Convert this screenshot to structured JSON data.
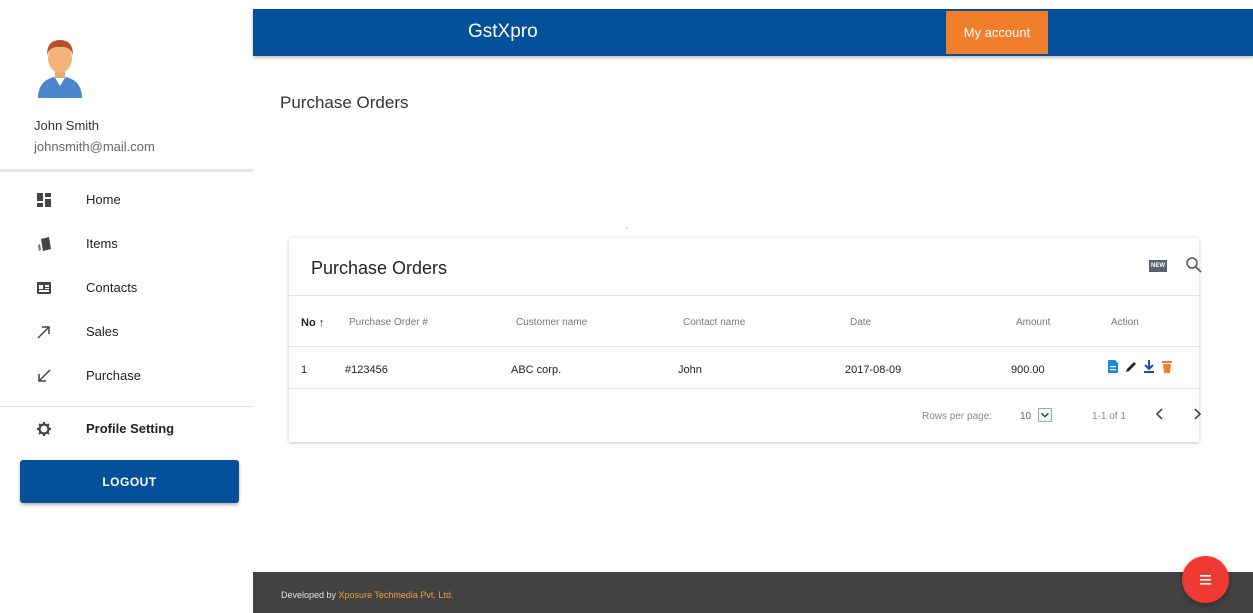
{
  "colors": {
    "primary": "#05509a",
    "accent": "#f07e2a",
    "fab": "#ef3a34",
    "footer_bg": "#424242",
    "action_blue": "#1e88e5",
    "action_orange": "#f07e2a"
  },
  "sidebar": {
    "user": {
      "name": "John Smith",
      "email": "johnsmith@mail.com",
      "avatar_icon": "user-avatar-icon"
    },
    "items": [
      {
        "label": "Home",
        "icon": "dashboard-icon"
      },
      {
        "label": "Items",
        "icon": "items-icon"
      },
      {
        "label": "Contacts",
        "icon": "contact-card-icon"
      },
      {
        "label": "Sales",
        "icon": "arrow-up-right-icon"
      },
      {
        "label": "Purchase",
        "icon": "arrow-down-left-icon"
      },
      {
        "label": "Profile Setting",
        "icon": "gear-icon"
      }
    ],
    "logout_label": "LOGOUT"
  },
  "header": {
    "title": "GstXpro",
    "account_label": "My account"
  },
  "page": {
    "title": "Purchase Orders"
  },
  "card": {
    "title": "Purchase Orders",
    "new_label": "NEW",
    "columns": {
      "no": "No",
      "po": "Purchase Order #",
      "customer": "Customer name",
      "contact": "Contact name",
      "date": "Date",
      "amount": "Amount",
      "action": "Action"
    },
    "rows": [
      {
        "no": "1",
        "po": "#123456",
        "customer": "ABC corp.",
        "contact": "John",
        "date": "2017-08-09",
        "amount": "900.00"
      }
    ],
    "pagination": {
      "rows_per_page_label": "Rows per page:",
      "rows_per_page": "10",
      "range": "1-1 of 1"
    }
  },
  "footer": {
    "prefix": "Developed by ",
    "company": "Xposure Techmedia Pvt. Ltd."
  }
}
